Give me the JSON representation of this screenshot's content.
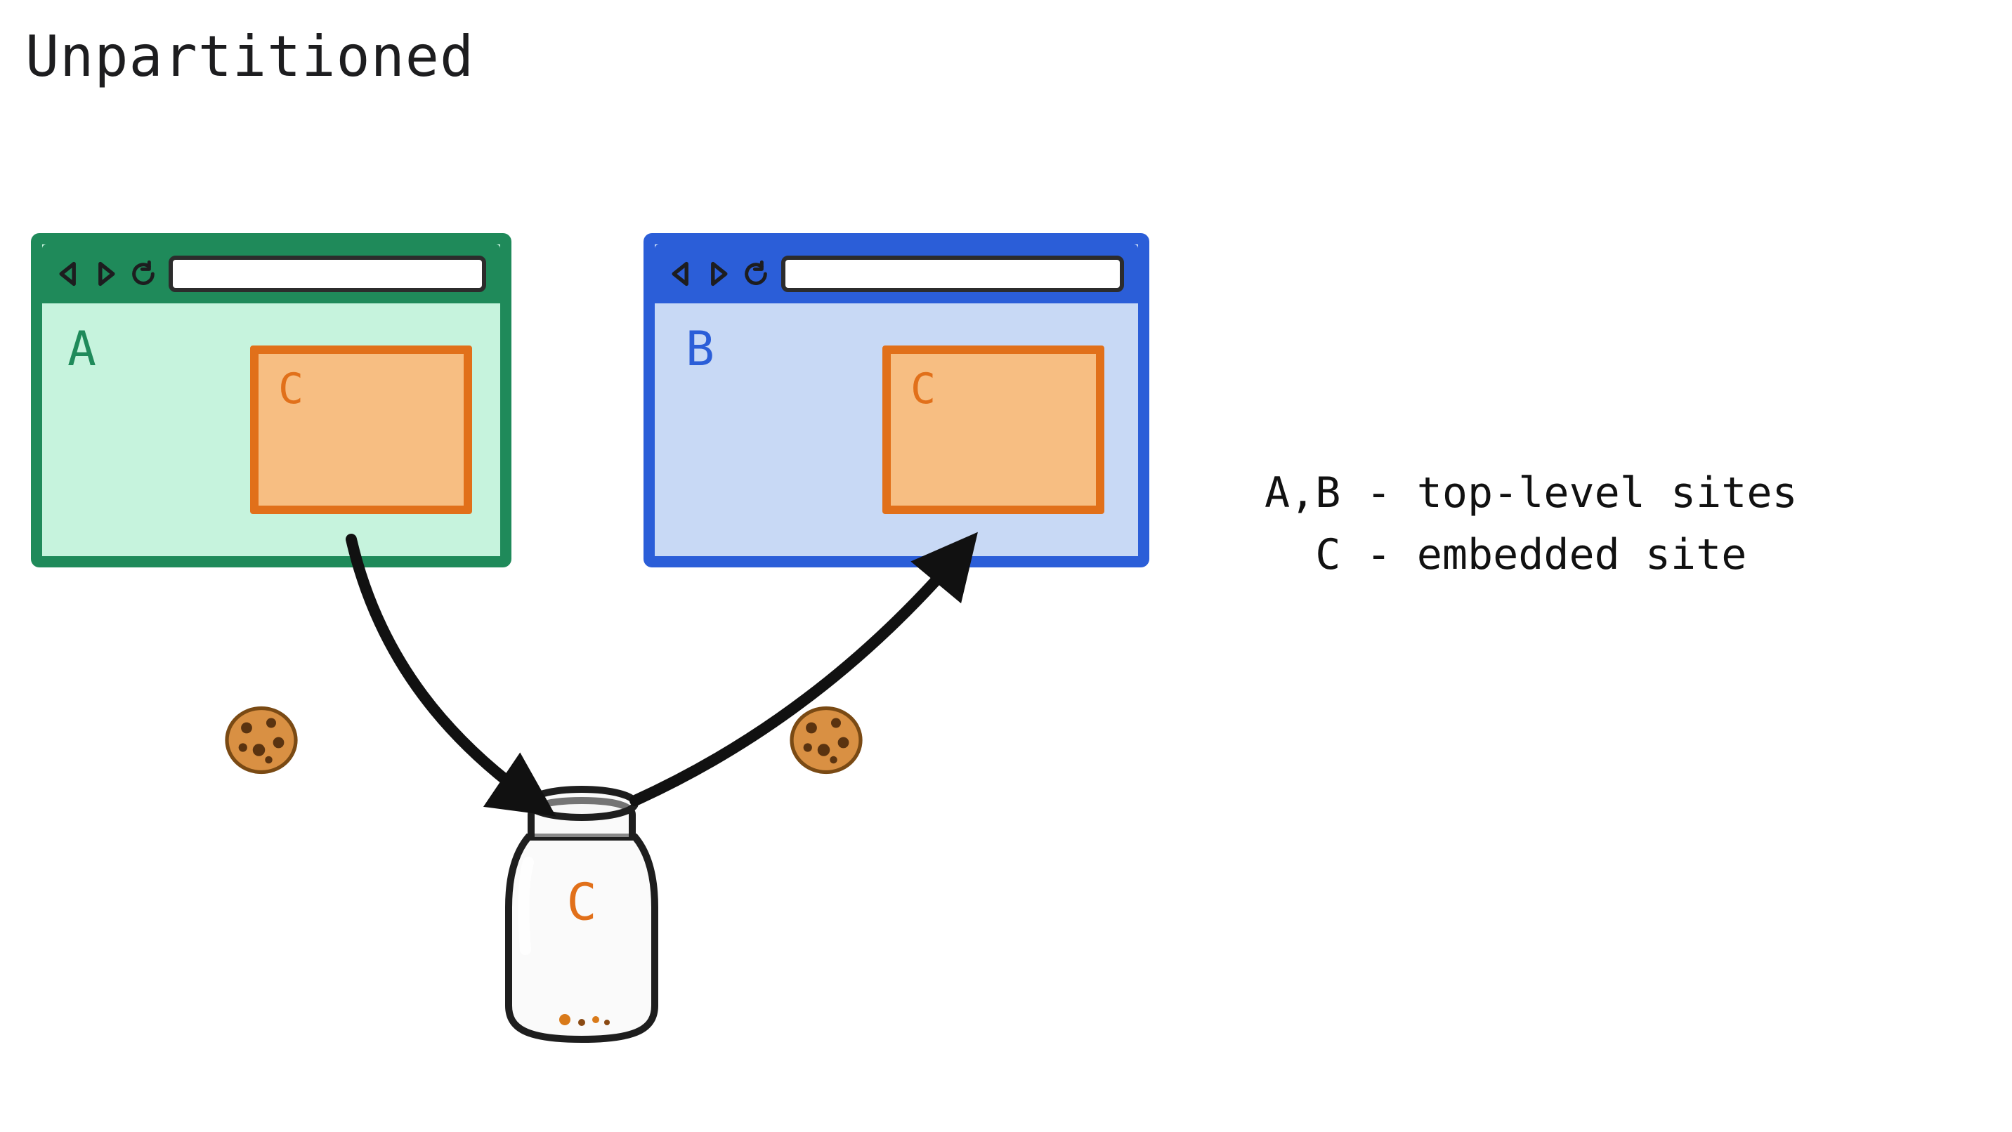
{
  "title": "Unpartitioned",
  "browsers": {
    "a": {
      "label": "A",
      "embed_label": "C"
    },
    "b": {
      "label": "B",
      "embed_label": "C"
    }
  },
  "jar": {
    "label": "C"
  },
  "legend": {
    "line1": "A,B - top-level sites",
    "line2": "  C - embedded site"
  },
  "icons": {
    "cookie_left": "cookie",
    "cookie_right": "cookie",
    "jar": "jar"
  }
}
